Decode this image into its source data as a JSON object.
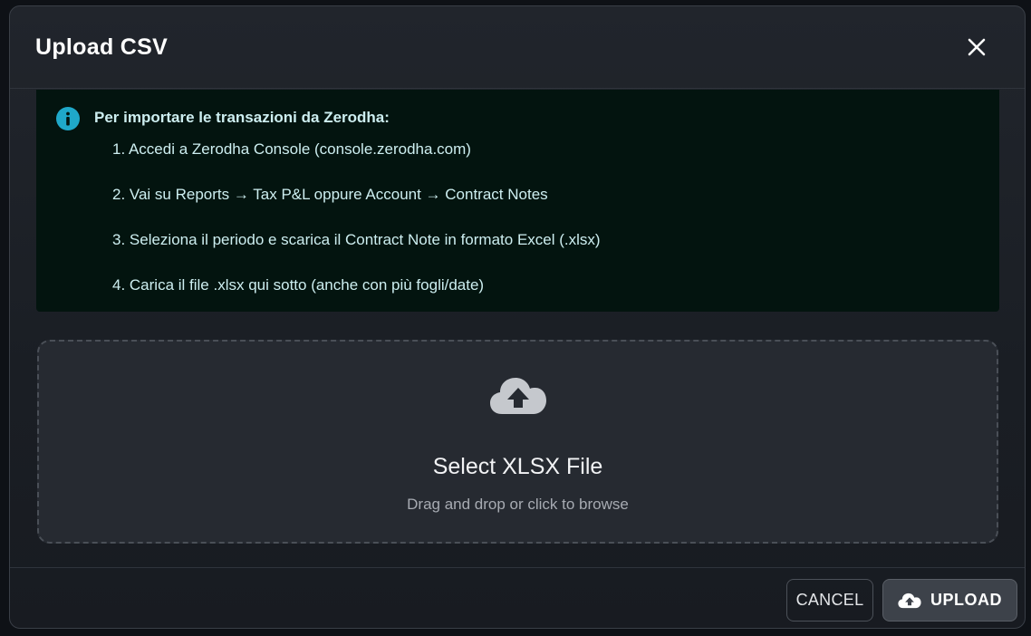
{
  "dialog": {
    "title": "Upload CSV",
    "close_icon": "close-icon"
  },
  "info": {
    "icon": "info-icon",
    "accent_color": "#1fa8c9",
    "heading": "Per importare le transazioni da Zerodha:",
    "steps": [
      "1. Accedi a Zerodha Console (console.zerodha.com)",
      "2. Vai su Reports → Tax P&L oppure Account → Contract Notes",
      "3. Seleziona il periodo e scarica il Contract Note in formato Excel (.xlsx)",
      "4. Carica il file .xlsx qui sotto (anche con più fogli/date)"
    ]
  },
  "dropzone": {
    "icon": "cloud-upload-icon",
    "title": "Select XLSX File",
    "subtitle": "Drag and drop or click to browse"
  },
  "footer": {
    "cancel_label": "CANCEL",
    "upload_label": "UPLOAD",
    "upload_icon": "cloud-upload-icon"
  }
}
